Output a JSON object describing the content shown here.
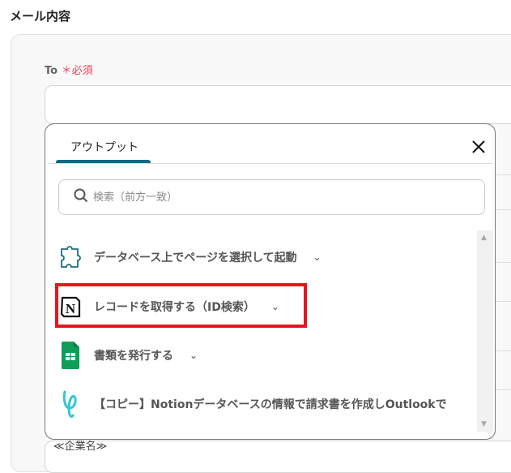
{
  "heading": "メール内容",
  "to_field": {
    "label": "To",
    "required_mark": "＊",
    "required_text": "必須",
    "value": ""
  },
  "bottom_field_text": "≪企業名≫",
  "popup": {
    "tab": "アウトプット",
    "search_placeholder": "検索（前方一致）",
    "items": [
      {
        "label": "データベース上でページを選択して起動",
        "icon": "puzzle-icon"
      },
      {
        "label": "レコードを取得する（ID検索）",
        "icon": "notion-icon"
      },
      {
        "label": "書類を発行する",
        "icon": "google-sheets-icon"
      },
      {
        "label": "【コピー】Notionデータベースの情報で請求書を作成しOutlookで",
        "icon": "yoom-icon"
      }
    ]
  },
  "colors": {
    "accent": "#0e6a80",
    "required": "#f0405a",
    "highlight": "#e8141e"
  }
}
